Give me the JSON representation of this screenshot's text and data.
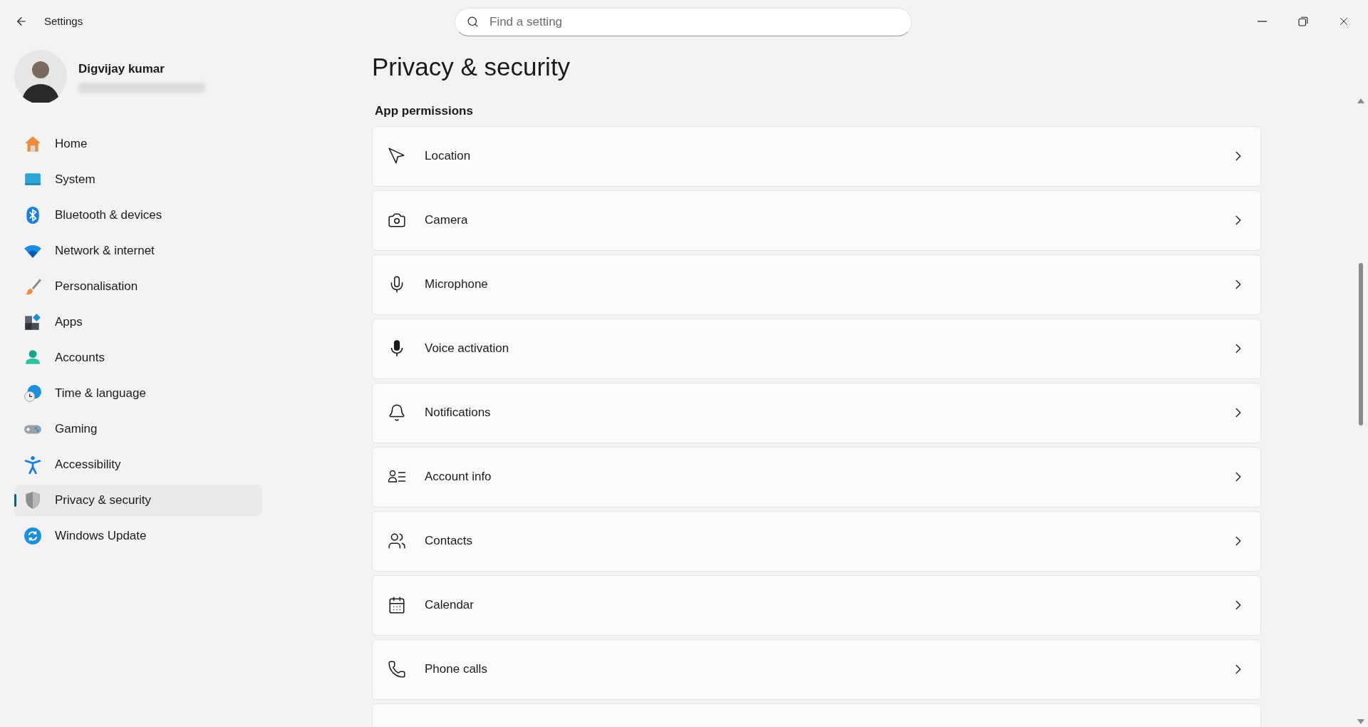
{
  "window": {
    "title": "Settings"
  },
  "search": {
    "placeholder": "Find a setting"
  },
  "user": {
    "name": "Digvijay kumar"
  },
  "sidebar": {
    "items": [
      {
        "label": "Home",
        "selected": false
      },
      {
        "label": "System",
        "selected": false
      },
      {
        "label": "Bluetooth & devices",
        "selected": false
      },
      {
        "label": "Network & internet",
        "selected": false
      },
      {
        "label": "Personalisation",
        "selected": false
      },
      {
        "label": "Apps",
        "selected": false
      },
      {
        "label": "Accounts",
        "selected": false
      },
      {
        "label": "Time & language",
        "selected": false
      },
      {
        "label": "Gaming",
        "selected": false
      },
      {
        "label": "Accessibility",
        "selected": false
      },
      {
        "label": "Privacy & security",
        "selected": true
      },
      {
        "label": "Windows Update",
        "selected": false
      }
    ]
  },
  "page": {
    "title": "Privacy & security",
    "section": "App permissions",
    "items": [
      {
        "label": "Location"
      },
      {
        "label": "Camera"
      },
      {
        "label": "Microphone"
      },
      {
        "label": "Voice activation"
      },
      {
        "label": "Notifications"
      },
      {
        "label": "Account info"
      },
      {
        "label": "Contacts"
      },
      {
        "label": "Calendar"
      },
      {
        "label": "Phone calls"
      }
    ]
  }
}
